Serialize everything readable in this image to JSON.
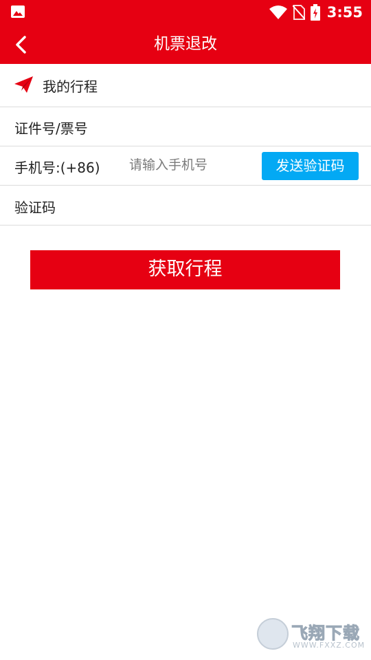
{
  "status_bar": {
    "time": "3:55",
    "icons": [
      "image-icon",
      "wifi-icon",
      "no-sim-icon",
      "battery-charging-icon"
    ]
  },
  "app_bar": {
    "title": "机票退改",
    "back_icon": "chevron-left-icon"
  },
  "rows": {
    "my_trip": {
      "icon": "paper-plane-icon",
      "label": "我的行程"
    },
    "id_ticket": {
      "label": "证件号/票号"
    },
    "phone": {
      "label": "手机号:(+86)",
      "placeholder": "请输入手机号",
      "value": "",
      "send_code_label": "发送验证码"
    },
    "verify_code": {
      "label": "验证码"
    }
  },
  "submit": {
    "label": "获取行程"
  },
  "watermark": {
    "text": "飞翔下载",
    "sub": "WWW.FXXZ.COM"
  },
  "colors": {
    "brand_red": "#e60012",
    "button_blue": "#03a9f4",
    "divider": "#dcdcdc"
  }
}
